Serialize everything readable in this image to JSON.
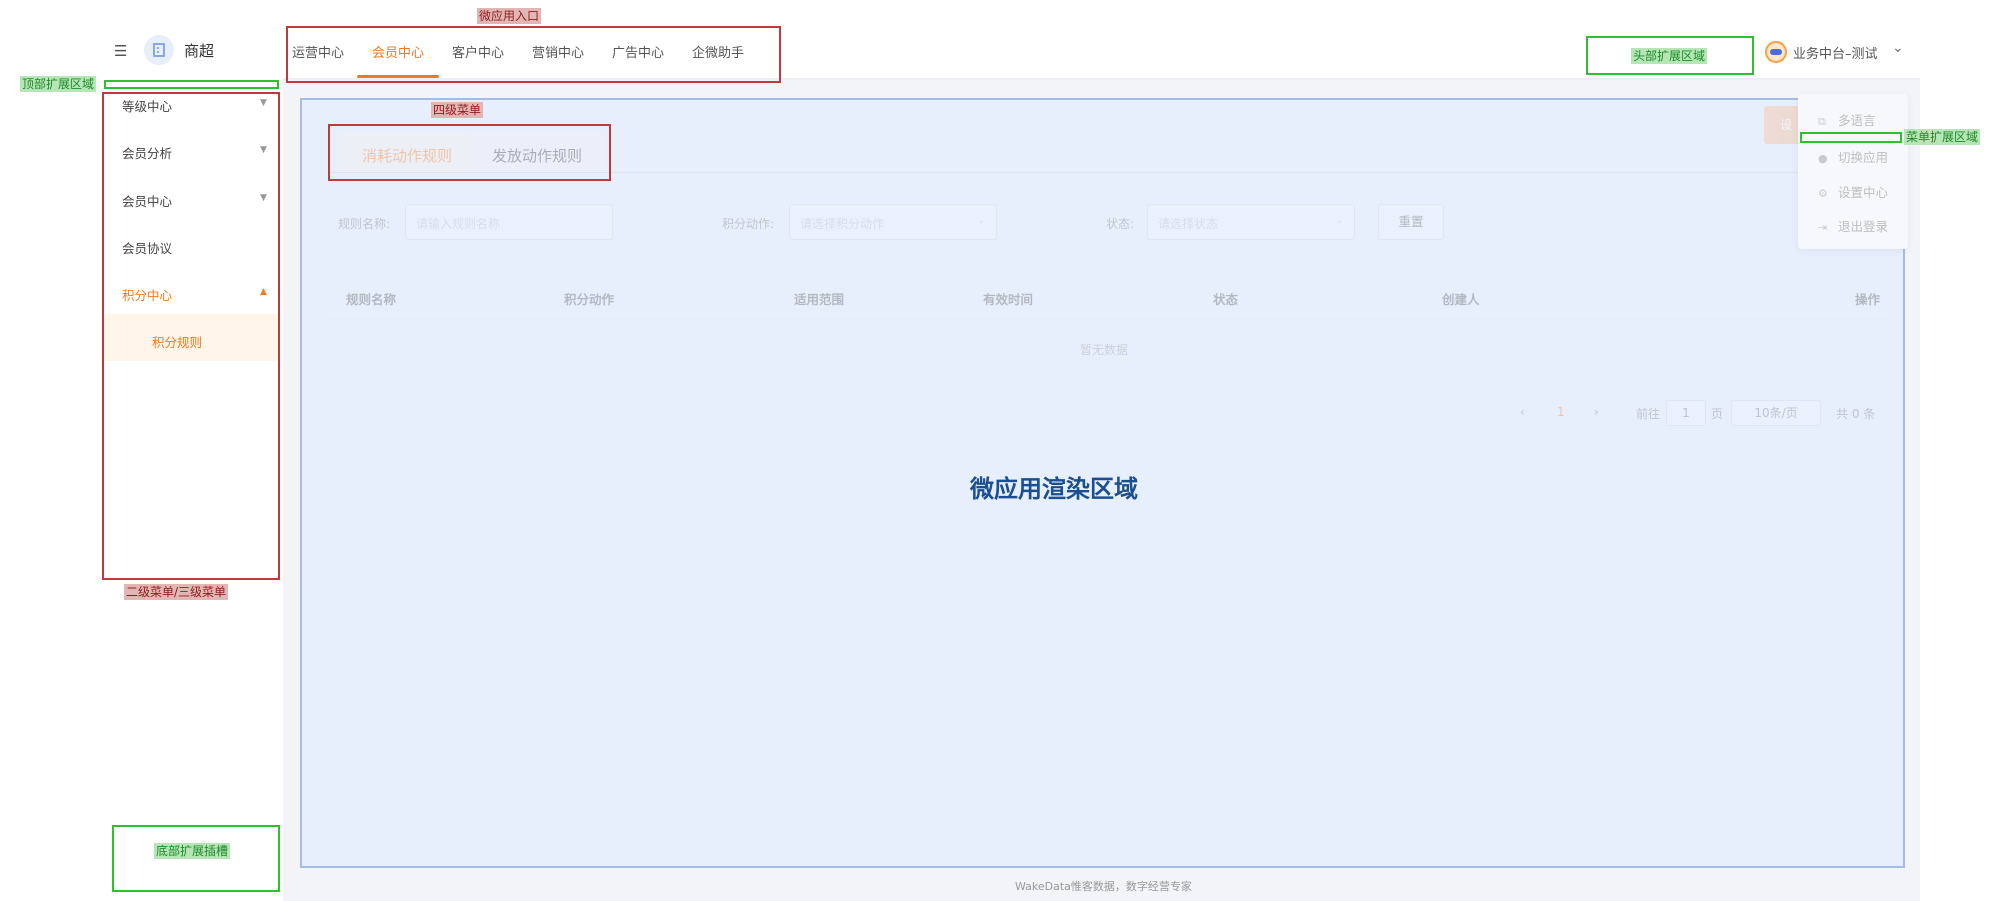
{
  "header": {
    "brand": "商超",
    "tabs": [
      {
        "label": "运营中心",
        "active": false
      },
      {
        "label": "会员中心",
        "active": true
      },
      {
        "label": "客户中心",
        "active": false
      },
      {
        "label": "营销中心",
        "active": false
      },
      {
        "label": "广告中心",
        "active": false
      },
      {
        "label": "企微助手",
        "active": false
      }
    ],
    "tenant_label": "业务中台–测试"
  },
  "sidebar": {
    "items": [
      {
        "label": "等级中心",
        "caret": "down"
      },
      {
        "label": "会员分析",
        "caret": "down"
      },
      {
        "label": "会员中心",
        "caret": "down"
      },
      {
        "label": "会员协议",
        "caret": ""
      },
      {
        "label": "积分中心",
        "caret": "up",
        "active": true
      }
    ],
    "subitem": "积分规则"
  },
  "micro_app": {
    "sub_tabs": [
      "消耗动作规则",
      "发放动作规则"
    ],
    "action_button": "设",
    "filters": [
      {
        "label": "规则名称:",
        "placeholder": "请输入规则名称"
      },
      {
        "label": "积分动作:",
        "placeholder": "请选择积分动作"
      },
      {
        "label": "状态:",
        "placeholder": "请选择状态"
      }
    ],
    "reset_button": "重置",
    "table_headers": [
      "规则名称",
      "积分动作",
      "适用范围",
      "有效时间",
      "状态",
      "创建人",
      "操作"
    ],
    "empty_text": "暂无数据",
    "pagination": {
      "prev": "‹",
      "current_page": "1",
      "next": "›",
      "goto_label": "前往",
      "goto_value": "1",
      "page_unit": "页",
      "page_size": "10条/页",
      "total": "共 0 条"
    },
    "render_area_title": "微应用渲染区域"
  },
  "user_menu": {
    "items": [
      {
        "label": "多语言",
        "icon": "language-icon"
      },
      {
        "label": "切换应用",
        "icon": "bell-icon"
      },
      {
        "label": "设置中心",
        "icon": "gear-icon"
      },
      {
        "label": "退出登录",
        "icon": "logout-icon"
      }
    ]
  },
  "footer": "WakeData惟客数据，数字经营专家",
  "annotations": {
    "micro_app_entry": "微应用入口",
    "top_extension": "顶部扩展区域",
    "fourth_menu": "四级菜单",
    "second_third_menu": "二级菜单/三级菜单",
    "bottom_slot": "底部扩展插槽",
    "header_extension": "头部扩展区域",
    "menu_extension": "菜单扩展区域"
  },
  "colors": {
    "accent": "#f07a1d",
    "annotation_red": "#c0393b",
    "annotation_green": "#2ec12e",
    "render_title": "#1b4f93"
  }
}
